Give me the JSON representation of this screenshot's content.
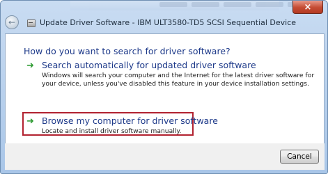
{
  "window": {
    "title": "Update Driver Software - IBM ULT3580-TD5 SCSI Sequential Device",
    "close_label": "×"
  },
  "main": {
    "heading": "How do you want to search for driver software?",
    "options": [
      {
        "title": "Search automatically for updated driver software",
        "description": "Windows will search your computer and the Internet for the latest driver software for your device, unless you've disabled this feature in your device installation settings."
      },
      {
        "title": "Browse my computer for driver software",
        "description": "Locate and install driver software manually.",
        "highlighted": true
      }
    ],
    "option_icon": "green-arrow-icon"
  },
  "footer": {
    "cancel_label": "Cancel"
  },
  "colors": {
    "link_blue": "#1e3a8a",
    "highlight_red": "#b22230",
    "arrow_green": "#2e9b33"
  }
}
